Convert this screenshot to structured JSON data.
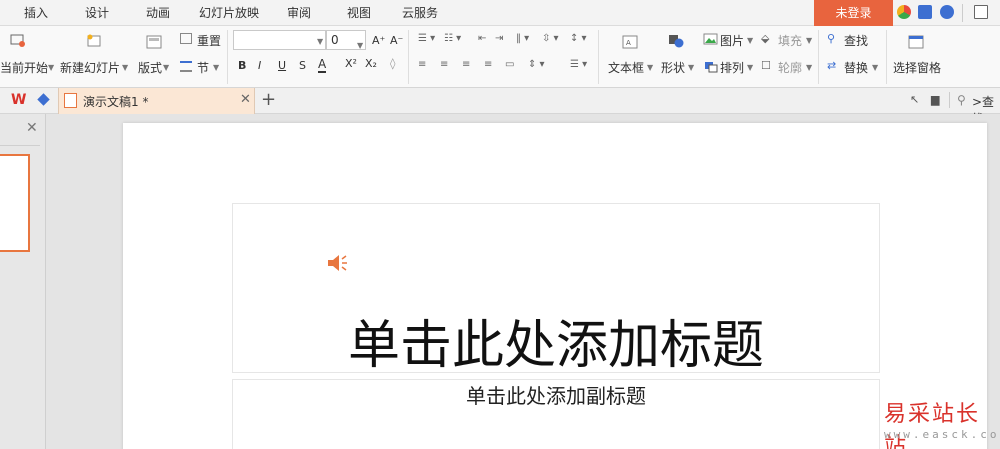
{
  "menu": {
    "tabs": [
      "插入",
      "设计",
      "动画",
      "幻灯片放映",
      "审阅",
      "视图",
      "云服务"
    ],
    "login": "未登录"
  },
  "ribbon": {
    "from_current": "当前开始",
    "new_slide": "新建幻灯片",
    "layout": "版式",
    "reset": "重置",
    "section": "节",
    "font_size": "0",
    "text_box": "文本框",
    "shape": "形状",
    "picture": "图片",
    "fill": "填充",
    "arrange": "排列",
    "outline": "轮廓",
    "find": "查找",
    "replace": "替换",
    "select_pane": "选择窗格"
  },
  "tabbar": {
    "doc_tab": "演示文稿1 *",
    "search_label": ">查找"
  },
  "slide": {
    "title_placeholder": "单击此处添加标题",
    "subtitle_placeholder": "单击此处添加副标题"
  },
  "watermark": {
    "brand": "易采站长站",
    "url": "www.easck.com"
  },
  "colors": {
    "accent": "#e8643e",
    "tab_active": "#fbe7d5",
    "speaker": "#e8763f"
  }
}
